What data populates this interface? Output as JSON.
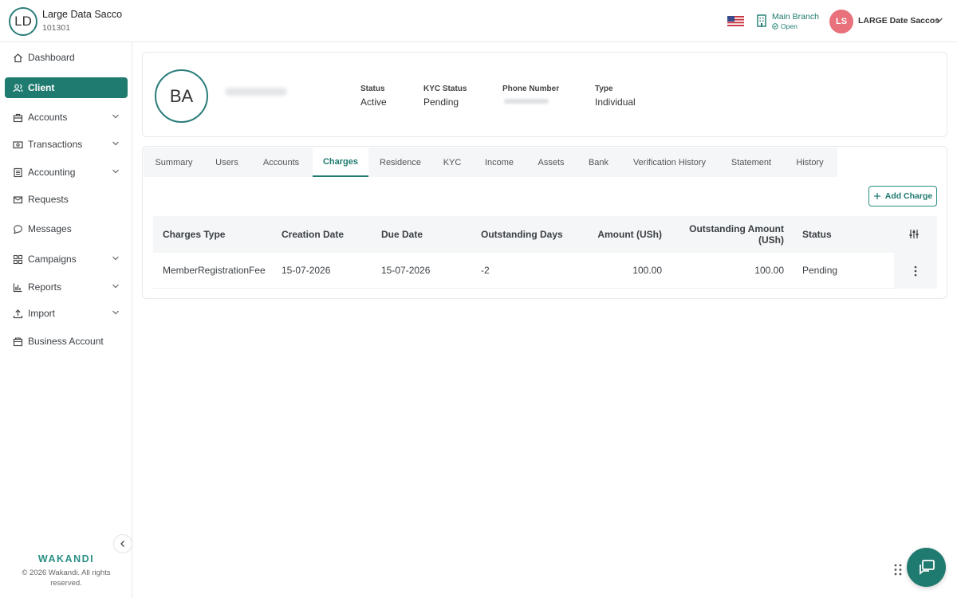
{
  "org": {
    "initials": "LD",
    "name": "Large Data Sacco",
    "code": "101301"
  },
  "header": {
    "flag_icon": "us-flag-icon",
    "branch_name": "Main Branch",
    "branch_status": "Open",
    "user_initials": "LS",
    "user_name": "LARGE Date Saccos",
    "accent_color": "#1f7a6f",
    "avatar_color": "#e8717b"
  },
  "sidebar": {
    "items": [
      {
        "label": "Dashboard",
        "icon": "home-icon"
      },
      {
        "label": "Client",
        "icon": "users-icon"
      },
      {
        "label": "Accounts",
        "icon": "briefcase-icon"
      },
      {
        "label": "Transactions",
        "icon": "cash-icon"
      },
      {
        "label": "Accounting",
        "icon": "ledger-icon"
      },
      {
        "label": "Requests",
        "icon": "mail-icon"
      },
      {
        "label": "Messages",
        "icon": "chat-icon"
      },
      {
        "label": "Campaigns",
        "icon": "grid-icon"
      },
      {
        "label": "Reports",
        "icon": "bar-chart-icon"
      },
      {
        "label": "Import",
        "icon": "upload-icon"
      },
      {
        "label": "Business Account",
        "icon": "wallet-icon"
      }
    ],
    "brand": "WAKANDI",
    "copyright": "© 2026 Wakandi. All rights reserved."
  },
  "profile": {
    "initials": "BA",
    "status_label": "Status",
    "status_value": "Active",
    "kyc_label": "KYC Status",
    "kyc_value": "Pending",
    "phone_label": "Phone Number",
    "type_label": "Type",
    "type_value": "Individual"
  },
  "tabs": [
    "Summary",
    "Users",
    "Accounts",
    "Charges",
    "Residence",
    "KYC",
    "Income",
    "Assets",
    "Bank",
    "Verification History",
    "Statement",
    "History"
  ],
  "active_tab": "Charges",
  "add_charge_label": "Add Charge",
  "table": {
    "headers": {
      "type": "Charges Type",
      "created": "Creation Date",
      "due": "Due Date",
      "days": "Outstanding Days",
      "amount": "Amount (USh)",
      "outstanding_l1": "Outstanding Amount",
      "outstanding_l2": "(USh)",
      "status": "Status"
    },
    "rows": [
      {
        "type": "MemberRegistrationFee",
        "created": "15-07-2026",
        "due": "15-07-2026",
        "days": "-2",
        "amount": "100.00",
        "outstanding": "100.00",
        "status": "Pending"
      }
    ]
  }
}
